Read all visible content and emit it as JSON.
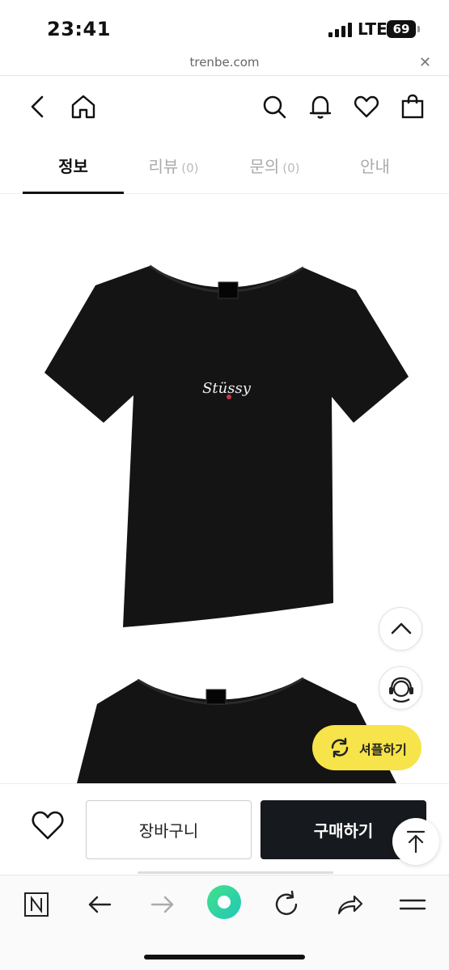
{
  "status": {
    "time": "23:41",
    "network": "LTE",
    "battery": "69"
  },
  "browser": {
    "url": "trenbe.com",
    "close_icon": "close-icon"
  },
  "header": {
    "icons": [
      "back-icon",
      "home-icon",
      "search-icon",
      "bell-icon",
      "heart-icon",
      "shopping-bag-icon"
    ]
  },
  "tabs": [
    {
      "label": "정보",
      "count": ""
    },
    {
      "label": "리뷰",
      "count": "(0)"
    },
    {
      "label": "문의",
      "count": "(0)"
    },
    {
      "label": "안내",
      "count": ""
    }
  ],
  "product": {
    "logo_text": "Stüssy"
  },
  "floating": {
    "shuffle_label": "셔플하기"
  },
  "actions": {
    "cart_label": "장바구니",
    "buy_label": "구매하기"
  },
  "colors": {
    "accent_yellow": "#f7e34a",
    "buy_button": "#16191d",
    "shirt": "#141414"
  }
}
